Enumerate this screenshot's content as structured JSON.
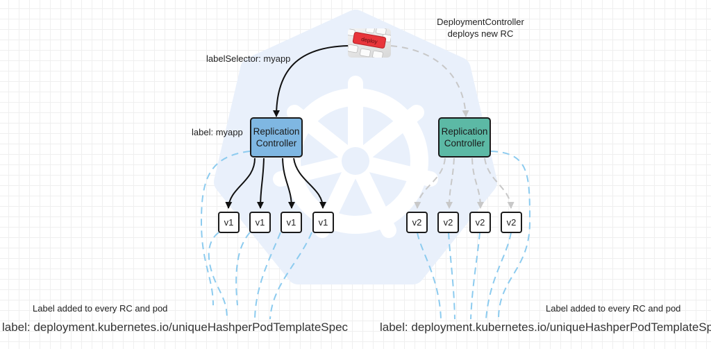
{
  "colors": {
    "rc_v1_fill": "#7fb7e2",
    "rc_v2_fill": "#5cb9a5",
    "logo_fill": "#e9f0fb",
    "label_link": "#8ccbef",
    "deploy_arrow": "#c8c8c8",
    "selector_arrow": "#111111",
    "deploy_key": "#e8353b"
  },
  "deploy_trigger": {
    "icon": "keyboard-deploy-key-icon",
    "key_label": "deploy"
  },
  "annotations": {
    "deployment_controller": [
      "DeploymentController",
      "deploys new RC"
    ],
    "label_selector": "labelSelector: myapp",
    "label": "label: myapp"
  },
  "replication_controllers": [
    {
      "id": "rc-v1",
      "label_lines": [
        "Replication",
        "Controller"
      ],
      "pods": [
        "v1",
        "v1",
        "v1",
        "v1"
      ],
      "arrow_style": "solid"
    },
    {
      "id": "rc-v2",
      "label_lines": [
        "Replication",
        "Controller"
      ],
      "pods": [
        "v2",
        "v2",
        "v2",
        "v2"
      ],
      "arrow_style": "dashed"
    }
  ],
  "footer": {
    "left": {
      "note": "Label added to every RC and pod",
      "label": "label: deployment.kubernetes.io/uniqueHashperPodTemplateSpec"
    },
    "right": {
      "note": "Label added to every RC and pod",
      "label": "label: deployment.kubernetes.io/uniqueHashperPodTemplateSpec"
    }
  }
}
